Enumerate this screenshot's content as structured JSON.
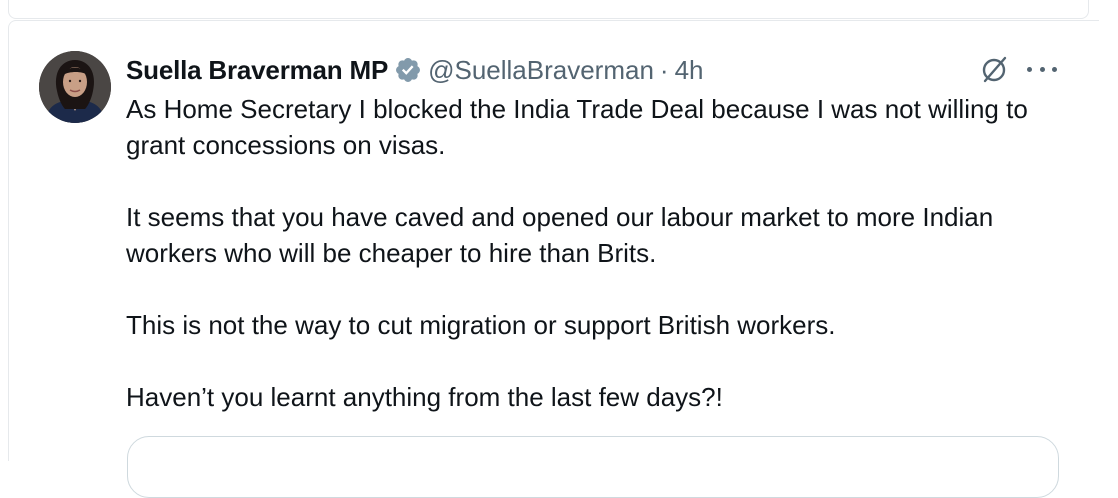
{
  "author": {
    "display_name": "Suella Braverman MP",
    "handle": "@SuellaBraverman",
    "separator": "·",
    "timestamp": "4h",
    "verified": true
  },
  "tweet": {
    "paragraphs": [
      "As Home Secretary I blocked the India Trade Deal because I was not willing to grant concessions on visas.",
      "It seems that you have caved and opened our labour market to more Indian workers who will be cheaper to hire than Brits.",
      "This is not the way to cut migration or support British workers.",
      "Haven’t you learnt anything from the last few days?!"
    ]
  },
  "icons": {
    "verified": "verified-badge-icon",
    "grok": "grok-icon",
    "more": "more-options-icon"
  },
  "colors": {
    "text_primary": "#0f1419",
    "text_secondary": "#536471",
    "border": "#cfd9de",
    "verified_badge": "#829aab"
  }
}
